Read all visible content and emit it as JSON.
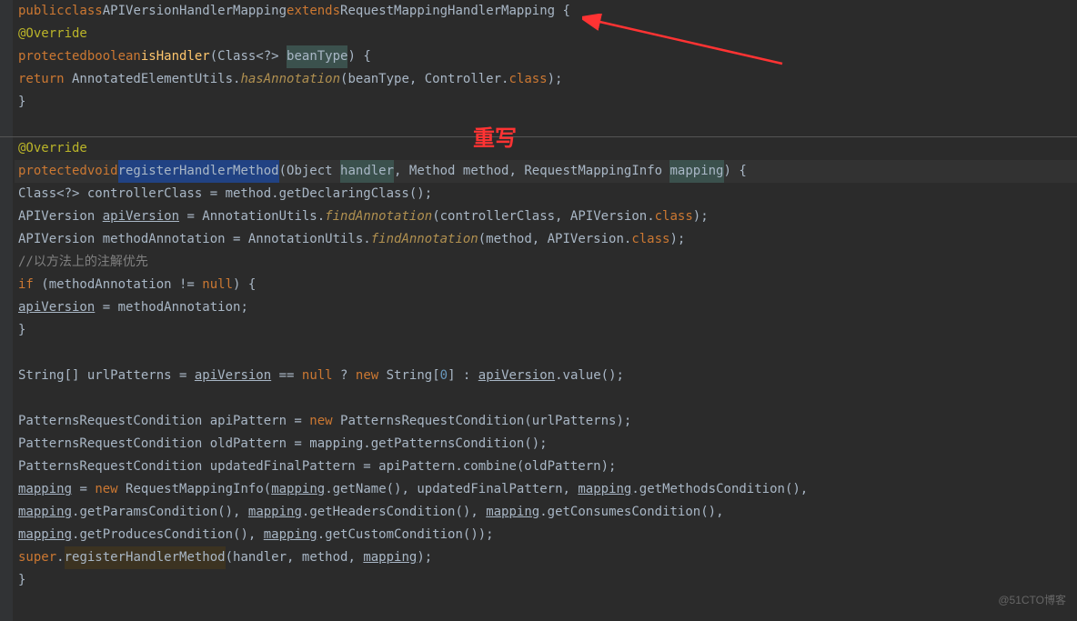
{
  "code": {
    "line1": {
      "kw1": "public",
      "kw2": "class",
      "type": "APIVersionHandlerMapping",
      "kw3": "extends",
      "ext": "RequestMappingHandlerMapping",
      "brace": " {"
    },
    "line2": {
      "anno": "@Override"
    },
    "line3": {
      "kw1": "protected",
      "kw2": "boolean",
      "method": "isHandler",
      "p1": "(Class<?> ",
      "param": "beanType",
      "p2": ") {"
    },
    "line4": {
      "kw": "return",
      "cls": " AnnotatedElementUtils.",
      "sm": "hasAnnotation",
      "args": "(beanType, Controller.",
      "kw2": "class",
      "end": ");"
    },
    "line5": {
      "brace": "}"
    },
    "line7": {
      "anno": "@Override"
    },
    "line8": {
      "kw1": "protected",
      "kw2": "void",
      "method": "registerHandlerMethod",
      "p1": "(Object ",
      "param1": "handler",
      "p2": ", Method method, RequestMappingInfo ",
      "param2": "mapping",
      "p3": ") {"
    },
    "line9": {
      "t1": "Class<?> controllerClass = method.getDeclaringClass();"
    },
    "line10": {
      "t1": "APIVersion ",
      "var": "apiVersion",
      "t2": " = AnnotationUtils.",
      "sm": "findAnnotation",
      "t3": "(controllerClass, APIVersion.",
      "kw": "class",
      "t4": ");"
    },
    "line11": {
      "t1": "APIVersion methodAnnotation = AnnotationUtils.",
      "sm": "findAnnotation",
      "t2": "(method, APIVersion.",
      "kw": "class",
      "t3": ");"
    },
    "line12": {
      "comment": "//以方法上的注解优先"
    },
    "line13": {
      "kw": "if",
      "t1": " (methodAnnotation != ",
      "kw2": "null",
      "t2": ") {"
    },
    "line14": {
      "var": "apiVersion",
      "t1": " = methodAnnotation;"
    },
    "line15": {
      "brace": "}"
    },
    "line17": {
      "t1": "String[] urlPatterns = ",
      "var": "apiVersion",
      "t2": " == ",
      "kw": "null",
      "t3": " ? ",
      "kw2": "new",
      "t4": " String[",
      "num": "0",
      "t5": "] : ",
      "var2": "apiVersion",
      "t6": ".value();"
    },
    "line19": {
      "t1": "PatternsRequestCondition apiPattern = ",
      "kw": "new",
      "t2": " PatternsRequestCondition(urlPatterns);"
    },
    "line20": {
      "t1": "PatternsRequestCondition oldPattern = mapping.getPatternsCondition();"
    },
    "line21": {
      "t1": "PatternsRequestCondition updatedFinalPattern = apiPattern.combine(oldPattern);"
    },
    "line22": {
      "var": "mapping",
      "t1": " = ",
      "kw": "new",
      "t2": " RequestMappingInfo(",
      "var2": "mapping",
      "t3": ".getName(), updatedFinalPattern, ",
      "var3": "mapping",
      "t4": ".getMethodsCondition(),"
    },
    "line23": {
      "var": "mapping",
      "t1": ".getParamsCondition(), ",
      "var2": "mapping",
      "t2": ".getHeadersCondition(), ",
      "var3": "mapping",
      "t3": ".getConsumesCondition(),"
    },
    "line24": {
      "var": "mapping",
      "t1": ".getProducesCondition(), ",
      "var2": "mapping",
      "t2": ".getCustomCondition());"
    },
    "line25": {
      "kw": "super",
      "t1": ".",
      "hl": "registerHandlerMethod",
      "t2": "(handler, method, ",
      "var": "mapping",
      "t3": ");"
    },
    "line26": {
      "brace": "}"
    }
  },
  "annotation": {
    "text": "重写"
  },
  "watermark": "@51CTO博客"
}
